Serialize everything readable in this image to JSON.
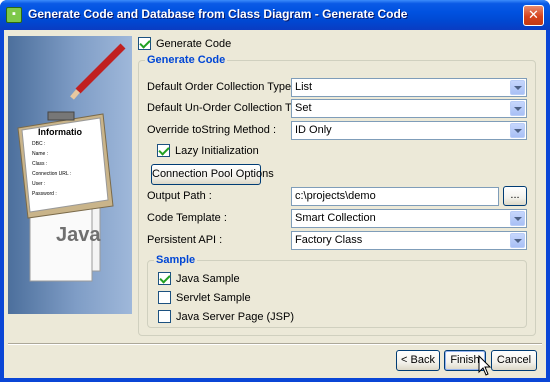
{
  "window": {
    "title": "Generate Code and Database from Class Diagram - Generate Code",
    "close_glyph": "✕"
  },
  "banner": {
    "doc_title": "Informatio",
    "doc_lines": [
      "DBC :",
      "Name :",
      "Class :",
      "Connection URL :",
      "User :",
      "Password :"
    ],
    "java_label": "Java"
  },
  "generate_code_checkbox": {
    "label": "Generate Code",
    "checked": true
  },
  "generate_code_group": {
    "title": "Generate Code",
    "default_order_collection_type": {
      "label": "Default Order Collection Type :",
      "value": "List"
    },
    "default_unorder_collection_type": {
      "label": "Default Un-Order Collection Type :",
      "value": "Set"
    },
    "override_tostring_method": {
      "label": "Override toString Method :",
      "value": "ID Only"
    },
    "lazy_initialization": {
      "label": "Lazy Initialization",
      "checked": true
    },
    "connection_pool_button": "Connection Pool Options",
    "output_path": {
      "label": "Output Path :",
      "value": "c:\\projects\\demo",
      "browse_label": "..."
    },
    "code_template": {
      "label": "Code Template :",
      "value": "Smart Collection"
    },
    "persistent_api": {
      "label": "Persistent API :",
      "value": "Factory Class"
    }
  },
  "sample_group": {
    "title": "Sample",
    "java_sample": {
      "label": "Java Sample",
      "checked": true
    },
    "servlet_sample": {
      "label": "Servlet Sample",
      "checked": false
    },
    "jsp": {
      "label": "Java Server Page (JSP)",
      "checked": false
    }
  },
  "footer": {
    "back": "< Back",
    "finish": "Finish",
    "cancel": "Cancel"
  }
}
